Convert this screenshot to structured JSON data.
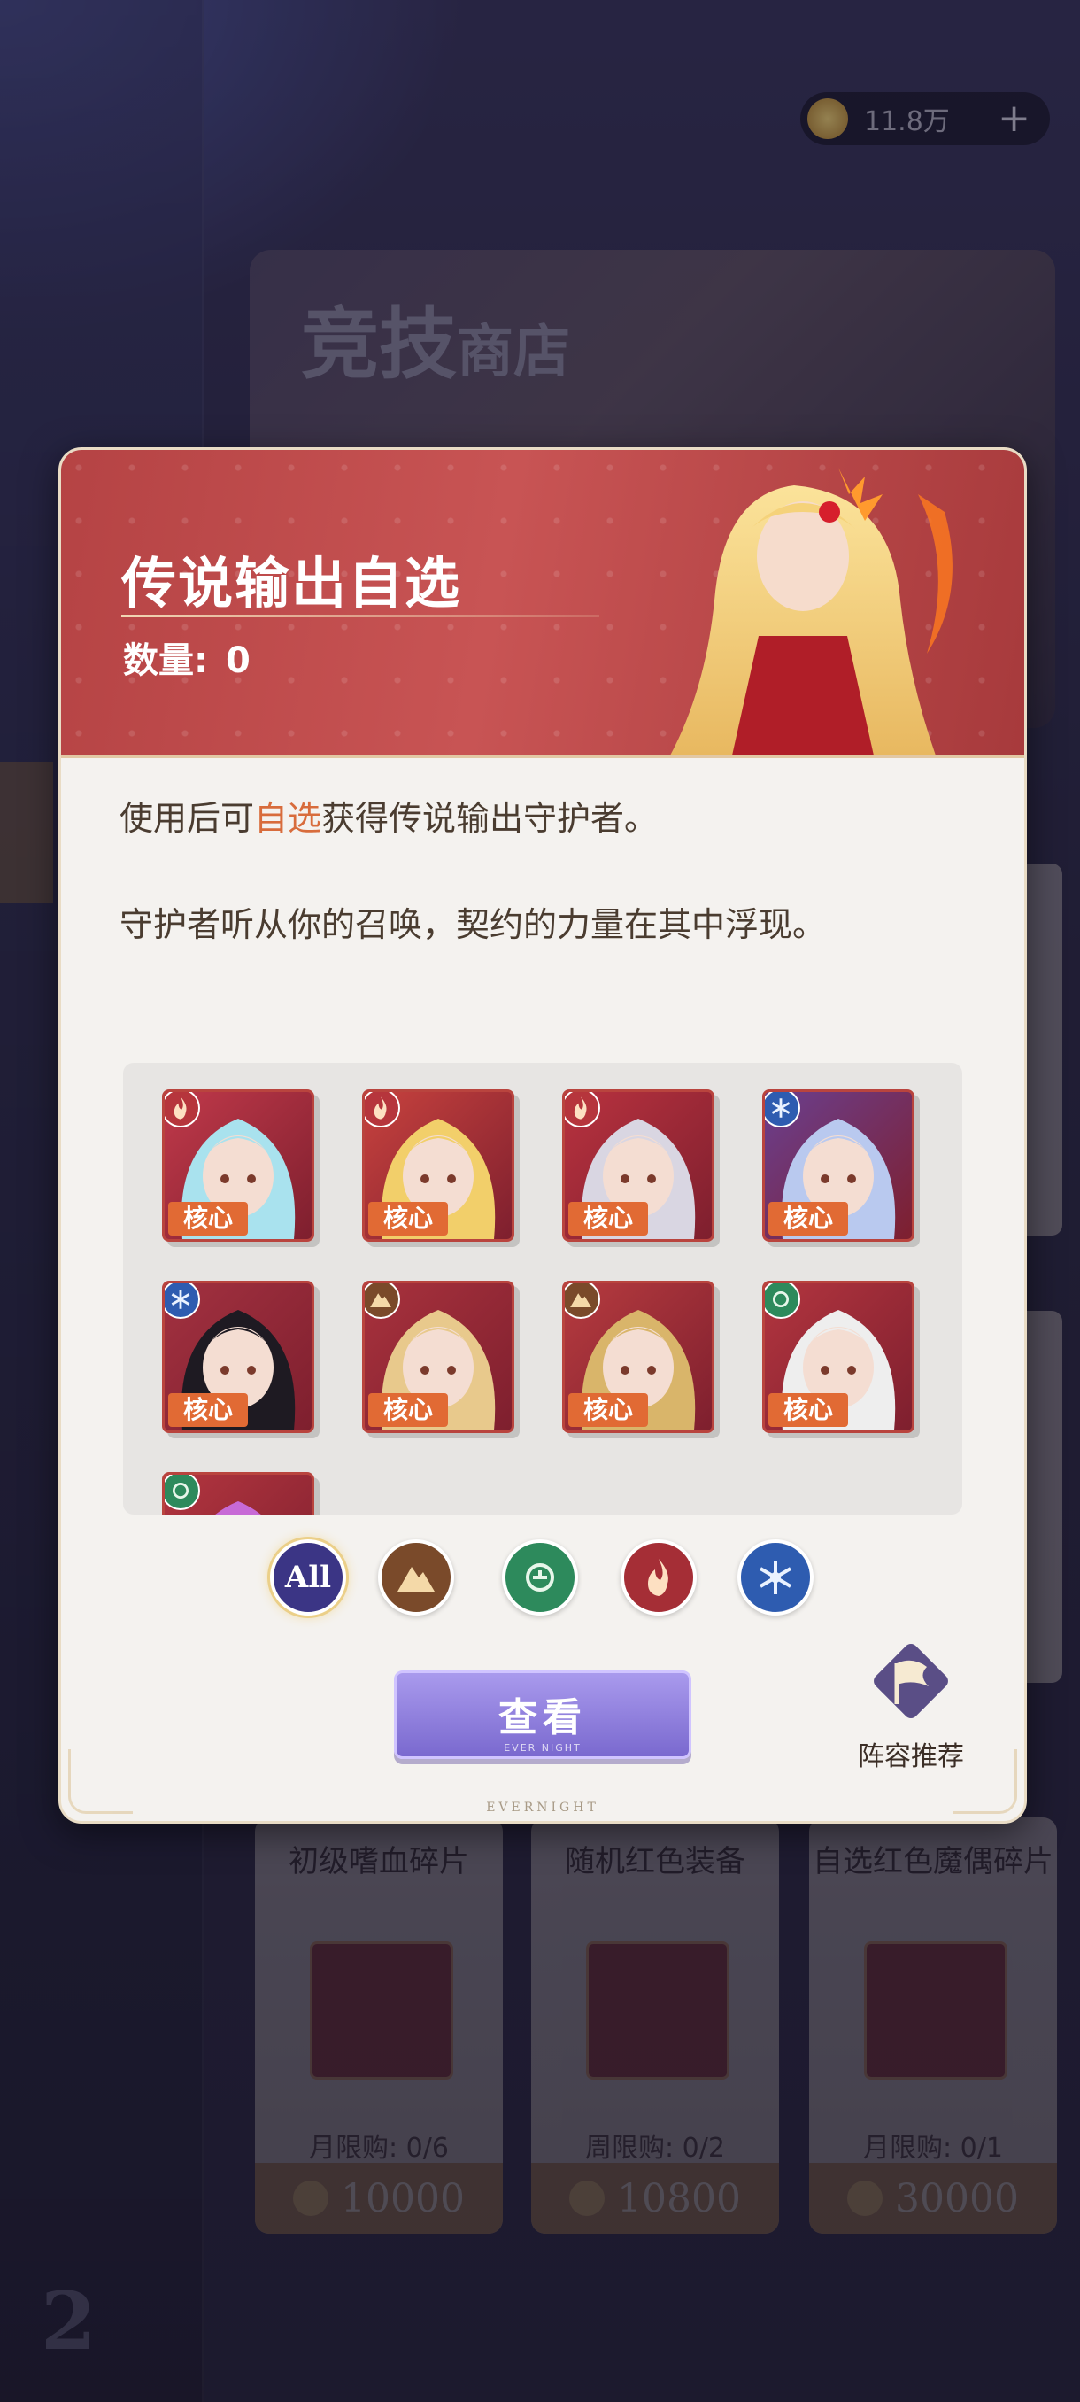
{
  "background": {
    "coins": "11.8万",
    "banner_title_1": "竞技",
    "banner_title_2": "商店",
    "items": [
      {
        "name": "初级嗜血碎片",
        "limit": "月限购: 0/6",
        "price": "10000"
      },
      {
        "name": "随机红色装备",
        "limit": "周限购: 0/2",
        "price": "10800"
      },
      {
        "name": "自选红色魔偶碎片",
        "limit": "月限购: 0/1",
        "price": "30000"
      }
    ]
  },
  "modal": {
    "title": "传说输出自选",
    "count_label": "数量:",
    "count_value": "0",
    "desc1_pre": "使用后可",
    "desc1_hl": "自选",
    "desc1_post": "获得传说输出守护者。",
    "desc2": "守护者听从你的召唤，契约的力量在其中浮现。",
    "core_label": "核心",
    "heroes": [
      {
        "element": "fire",
        "hair": "#a9e2ee",
        "bg": "#c0394a"
      },
      {
        "element": "fire",
        "hair": "#f2cf6a",
        "bg": "#c7423e"
      },
      {
        "element": "fire",
        "hair": "#d9d6e2",
        "bg": "#b8323f"
      },
      {
        "element": "ice",
        "hair": "#b9c9ef",
        "bg": "#6a3f8f"
      },
      {
        "element": "ice",
        "hair": "#1e1a22",
        "bg": "#a23140"
      },
      {
        "element": "earth",
        "hair": "#e8c98c",
        "bg": "#a8323d"
      },
      {
        "element": "earth",
        "hair": "#d9b56a",
        "bg": "#b63b3f"
      },
      {
        "element": "wind",
        "hair": "#eeeeee",
        "bg": "#b2353f"
      },
      {
        "element": "wind",
        "hair": "#c76ad6",
        "bg": "#b2353f"
      }
    ],
    "filter_all": "All",
    "view_button": "查看",
    "view_button_sub": "EVER NIGHT",
    "lineup_label": "阵容推荐",
    "footer": "EVERNIGHT"
  },
  "colors": {
    "header_red": "#b54344",
    "highlight": "#d86c3c",
    "core_badge": "#e16a34",
    "button_purple": "#8a7ad8"
  }
}
